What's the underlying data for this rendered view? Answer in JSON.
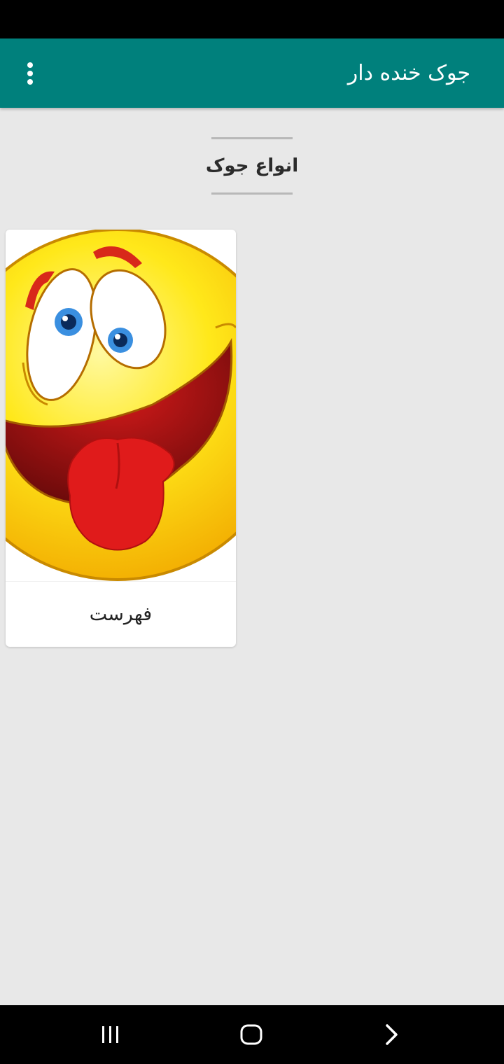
{
  "app_bar": {
    "title": "جوک خنده دار",
    "menu_icon": "more-vert-icon",
    "background_color": "#00807c"
  },
  "section": {
    "heading": "انواع جوک"
  },
  "cards": [
    {
      "label": "فهرست",
      "image": "laughing-emoji-tongue-out"
    }
  ],
  "nav_bar": {
    "recents_icon": "recent-apps-icon",
    "home_icon": "home-icon",
    "back_icon": "back-chevron-icon"
  }
}
